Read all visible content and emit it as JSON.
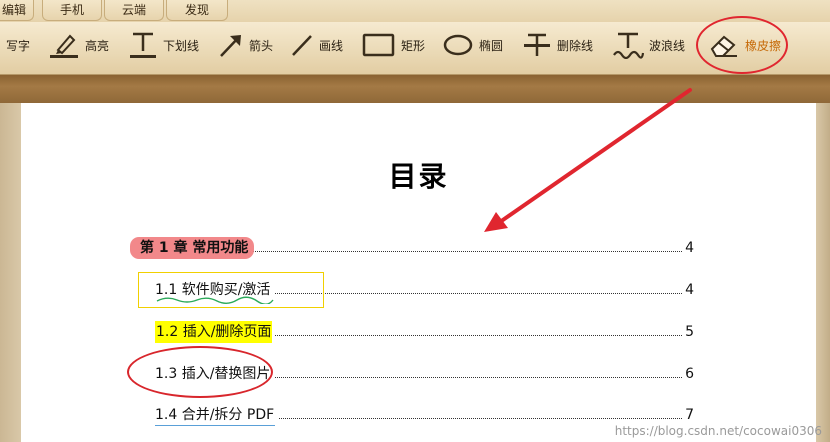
{
  "tabs": [
    "编辑",
    "手机",
    "云端",
    "发现"
  ],
  "tools": {
    "write_label": "写字",
    "highlight_label": "高亮",
    "underline_label": "下划线",
    "arrow_label": "箭头",
    "line_label": "画线",
    "rect_label": "矩形",
    "ellipse_label": "椭圆",
    "strike_label": "删除线",
    "wavy_label": "波浪线",
    "eraser_label": "橡皮擦"
  },
  "document": {
    "title": "目录",
    "toc": [
      {
        "label": "第 1 章  常用功能",
        "page": "4"
      },
      {
        "label": "1.1 软件购买/激活",
        "page": "4"
      },
      {
        "label": "1.2 插入/删除页面",
        "page": "5"
      },
      {
        "label": "1.3 插入/替换图片",
        "page": "6"
      },
      {
        "label": "1.4 合并/拆分 PDF",
        "page": "7"
      }
    ]
  },
  "watermark": "https://blog.csdn.net/cocowai0306",
  "colors": {
    "annotation_red": "#e0262f",
    "highlight_yellow": "#ffff00",
    "chapter_highlight": "#f2888a",
    "eraser_text": "#c66a08"
  }
}
